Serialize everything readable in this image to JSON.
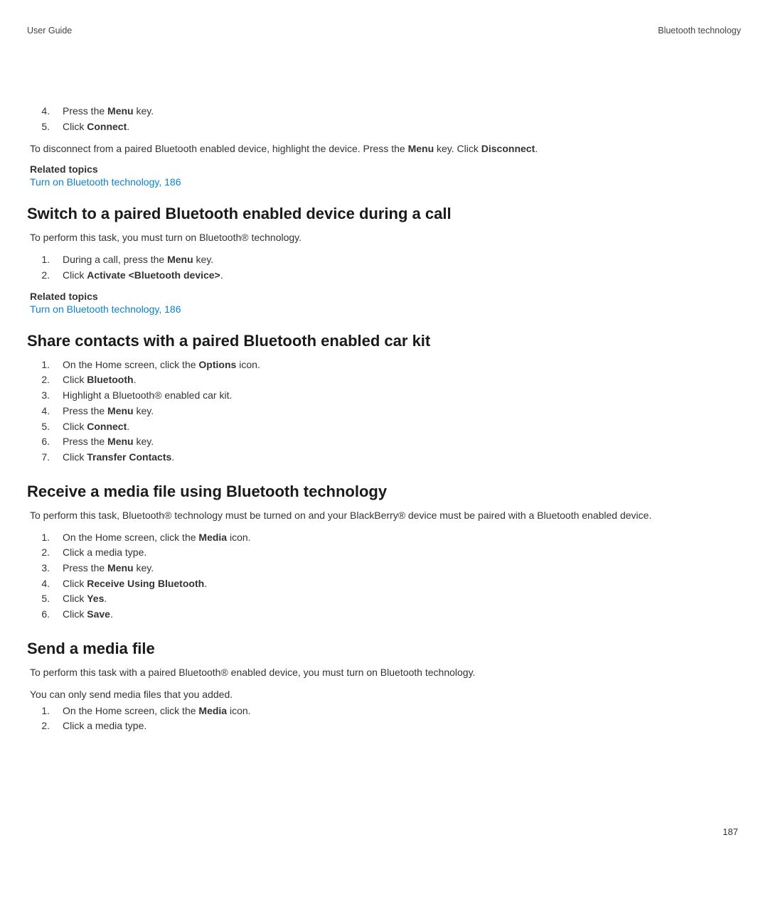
{
  "header": {
    "left": "User Guide",
    "right": "Bluetooth technology"
  },
  "intro_steps": [
    {
      "n": "4.",
      "pre": "Press the ",
      "bold": "Menu",
      "post": " key."
    },
    {
      "n": "5.",
      "pre": "Click ",
      "bold": "Connect",
      "post": "."
    }
  ],
  "intro_note": {
    "pre": "To disconnect from a paired Bluetooth enabled device, highlight the device. Press the ",
    "b1": "Menu",
    "mid": " key. Click ",
    "b2": "Disconnect",
    "post": "."
  },
  "related_label": "Related topics",
  "related_link": "Turn on Bluetooth technology, 186",
  "s1": {
    "title": "Switch to a paired Bluetooth enabled device during a call",
    "intro": "To perform this task, you must turn on Bluetooth® technology.",
    "steps": [
      {
        "n": "1.",
        "pre": "During a call, press the ",
        "bold": "Menu",
        "post": " key."
      },
      {
        "n": "2.",
        "pre": "Click ",
        "bold": "Activate <Bluetooth device>",
        "post": "."
      }
    ]
  },
  "s2": {
    "title": "Share contacts with a paired Bluetooth enabled car kit",
    "steps": [
      {
        "n": "1.",
        "pre": "On the Home screen, click the ",
        "bold": "Options",
        "post": " icon."
      },
      {
        "n": "2.",
        "pre": "Click ",
        "bold": "Bluetooth",
        "post": "."
      },
      {
        "n": "3.",
        "pre": "Highlight a Bluetooth® enabled car kit.",
        "bold": "",
        "post": ""
      },
      {
        "n": "4.",
        "pre": "Press the ",
        "bold": "Menu",
        "post": " key."
      },
      {
        "n": "5.",
        "pre": "Click ",
        "bold": "Connect",
        "post": "."
      },
      {
        "n": "6.",
        "pre": "Press the ",
        "bold": "Menu",
        "post": " key."
      },
      {
        "n": "7.",
        "pre": "Click ",
        "bold": "Transfer Contacts",
        "post": "."
      }
    ]
  },
  "s3": {
    "title": "Receive a media file using Bluetooth technology",
    "intro": "To perform this task, Bluetooth® technology must be turned on and your BlackBerry® device must be paired with a Bluetooth enabled device.",
    "steps": [
      {
        "n": "1.",
        "pre": "On the Home screen, click the ",
        "bold": "Media",
        "post": " icon."
      },
      {
        "n": "2.",
        "pre": "Click a media type.",
        "bold": "",
        "post": ""
      },
      {
        "n": "3.",
        "pre": "Press the ",
        "bold": "Menu",
        "post": " key."
      },
      {
        "n": "4.",
        "pre": "Click ",
        "bold": "Receive Using Bluetooth",
        "post": "."
      },
      {
        "n": "5.",
        "pre": "Click ",
        "bold": "Yes",
        "post": "."
      },
      {
        "n": "6.",
        "pre": "Click ",
        "bold": "Save",
        "post": "."
      }
    ]
  },
  "s4": {
    "title": "Send a media file",
    "intro1": "To perform this task with a paired Bluetooth® enabled device, you must turn on Bluetooth technology.",
    "intro2": "You can only send media files that you added.",
    "steps": [
      {
        "n": "1.",
        "pre": "On the Home screen, click the ",
        "bold": "Media",
        "post": " icon."
      },
      {
        "n": "2.",
        "pre": "Click a media type.",
        "bold": "",
        "post": ""
      }
    ]
  },
  "page_number": "187"
}
